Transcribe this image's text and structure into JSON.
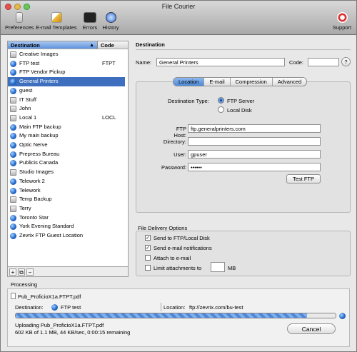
{
  "window": {
    "title": "File Courier"
  },
  "toolbar": {
    "items": [
      {
        "label": "Preferences",
        "icon": "preferences-icon"
      },
      {
        "label": "E-mail Templates",
        "icon": "email-templates-icon"
      },
      {
        "label": "Errors",
        "icon": "errors-icon"
      },
      {
        "label": "History",
        "icon": "history-icon"
      },
      {
        "label": "Support",
        "icon": "support-icon"
      }
    ]
  },
  "list": {
    "columns": [
      "Destination",
      "Code"
    ],
    "rows": [
      {
        "name": "Creative Images",
        "code": "",
        "icon": "disk"
      },
      {
        "name": "FTP test",
        "code": "FTPT",
        "icon": "globe"
      },
      {
        "name": "FTP Vendor Pickup",
        "code": "",
        "icon": "globe"
      },
      {
        "name": "General Printers",
        "code": "",
        "icon": "globe"
      },
      {
        "name": "guest",
        "code": "",
        "icon": "globe"
      },
      {
        "name": "IT Stuff",
        "code": "",
        "icon": "disk"
      },
      {
        "name": "John",
        "code": "",
        "icon": "disk"
      },
      {
        "name": "Local 1",
        "code": "LOCL",
        "icon": "disk"
      },
      {
        "name": "Main FTP backup",
        "code": "",
        "icon": "globe"
      },
      {
        "name": "My main backup",
        "code": "",
        "icon": "globe"
      },
      {
        "name": "Optic Nerve",
        "code": "",
        "icon": "globe"
      },
      {
        "name": "Prepress Bureau",
        "code": "",
        "icon": "globe"
      },
      {
        "name": "Publicis Canada",
        "code": "",
        "icon": "globe"
      },
      {
        "name": "Studio Images",
        "code": "",
        "icon": "disk"
      },
      {
        "name": "Telework 2",
        "code": "",
        "icon": "globe"
      },
      {
        "name": "Telework",
        "code": "",
        "icon": "globe"
      },
      {
        "name": "Temp Backup",
        "code": "",
        "icon": "disk"
      },
      {
        "name": "Terry",
        "code": "",
        "icon": "disk"
      },
      {
        "name": "Toronto Star",
        "code": "",
        "icon": "globe"
      },
      {
        "name": "York Evening Standard",
        "code": "",
        "icon": "globe"
      },
      {
        "name": "Zevrix FTP Guest Location",
        "code": "",
        "icon": "globe"
      }
    ],
    "selected": 3,
    "buttons": [
      "+",
      "⧉",
      "−"
    ]
  },
  "destination": {
    "section_title": "Destination",
    "name_label": "Name:",
    "name_value": "General Printers",
    "code_label": "Code:",
    "code_value": "",
    "help": "?",
    "tabs": [
      "Location",
      "E-mail",
      "Compression",
      "Advanced"
    ],
    "active_tab": 0,
    "type_label": "Destination Type:",
    "type_options": [
      "FTP Server",
      "Local Disk"
    ],
    "type_selected": 0,
    "ftp_host_label": "FTP Host:",
    "ftp_host": "ftp.generalprinters.com",
    "directory_label": "Directory:",
    "directory": "",
    "user_label": "User:",
    "user": "gpuser",
    "password_label": "Password:",
    "password": "••••••",
    "test_button": "Test FTP"
  },
  "delivery": {
    "title": "File Delivery Options",
    "options": [
      {
        "label": "Send to FTP/Local Disk",
        "checked": true
      },
      {
        "label": "Send e-mail notifications",
        "checked": true
      },
      {
        "label": "Attach to e-mail",
        "checked": false
      },
      {
        "label": "Limit attachments to",
        "checked": false
      }
    ],
    "limit_value": "",
    "limit_unit": "MB"
  },
  "processing": {
    "title": "Processing",
    "file": "Pub_ProficioX1a.FTPT.pdf",
    "dest_label": "Destination:",
    "dest_name": "FTP test",
    "location_label": "Location:",
    "location_value": "ftp://zevrix.com/bu-test",
    "progress": 0.91,
    "status_line1": "Uploading Pub_ProficioX1a.FTPT.pdf",
    "status_line2": "602 KB of 1.1 MB, 44 KB/sec, 0:00:15 remaining",
    "cancel": "Cancel"
  }
}
